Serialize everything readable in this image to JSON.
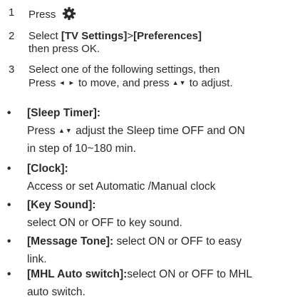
{
  "steps": [
    {
      "num": "1",
      "text": "Press",
      "icon": "gear-icon"
    },
    {
      "num": "2",
      "label1": "[TV Settings]",
      "sep": ">",
      "label2": "[Preferences]",
      "pre": "Select ",
      "line2": "then press OK."
    },
    {
      "num": "3",
      "line1": "Select one of the following settings, then",
      "line2a": "Press",
      "arrows_lr": "◄ ►",
      "line2b": "to move, and press",
      "arrows_ud": "▲▼",
      "line2c": "to adjust."
    }
  ],
  "bullets": [
    {
      "title": "[Sleep Timer]:",
      "line1a": "Press",
      "arrows_ud": "▲▼",
      "line1b": "adjust the Sleep time OFF and ON",
      "line2": "in step of 10~180 min."
    },
    {
      "title": "[Clock]:",
      "line1": "Access or set Automatic /Manual clock"
    },
    {
      "title": "[Key Sound]:",
      "line1": "select ON or OFF to key sound."
    },
    {
      "title": "[Message Tone]:",
      "rest": " select ON or OFF to easy",
      "line2": "link."
    },
    {
      "title": "[MHL Auto switch]:",
      "rest": "select ON or OFF to MHL",
      "line2": "auto switch."
    }
  ],
  "bullet_symbol": "•"
}
